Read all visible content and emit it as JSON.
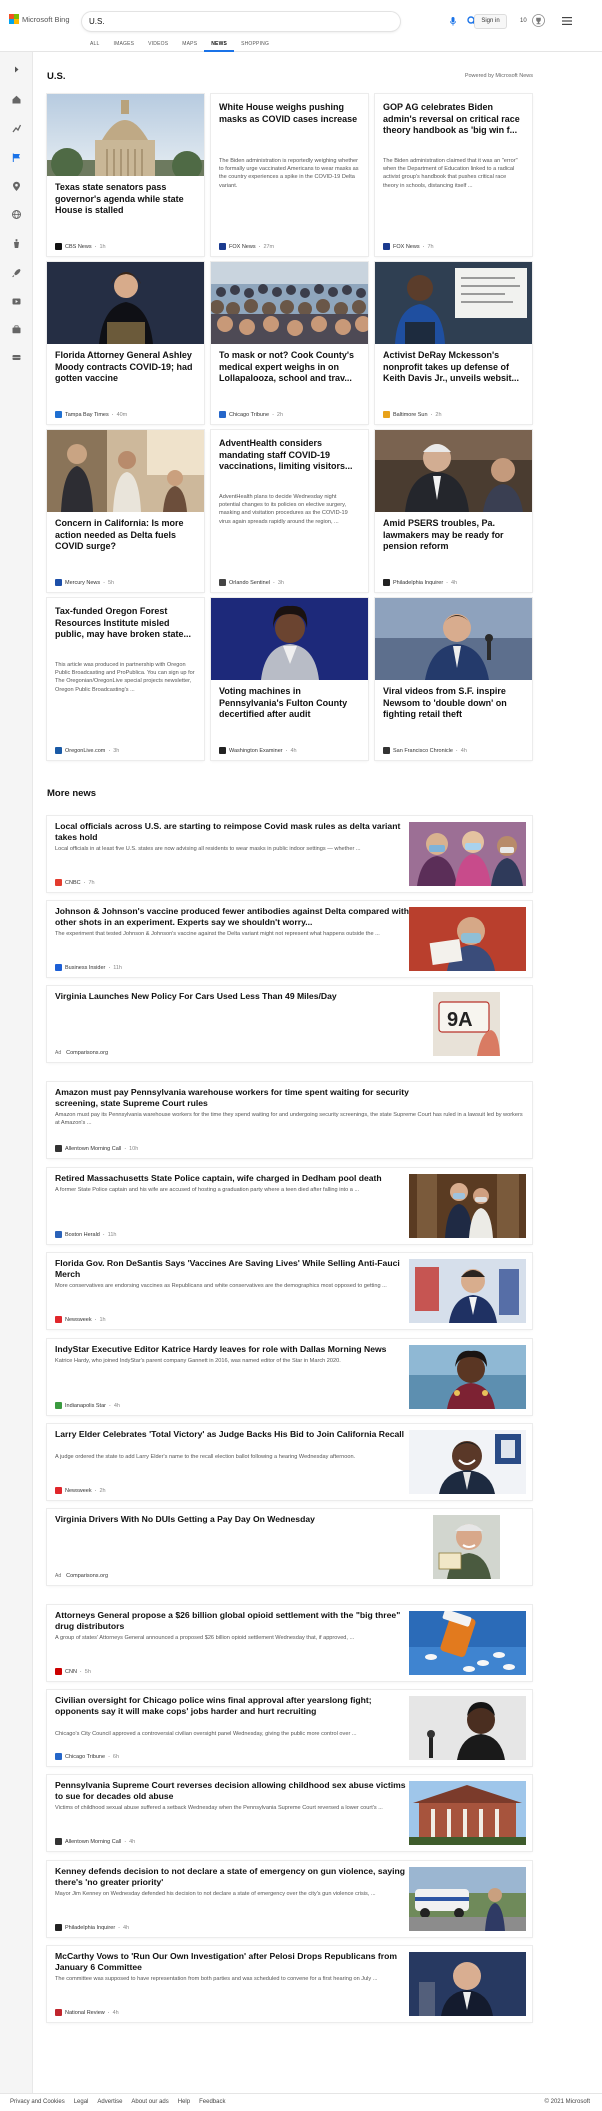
{
  "brand": {
    "name": "Microsoft Bing"
  },
  "search": {
    "value": "U.S."
  },
  "header": {
    "signin_label": "Sign in",
    "rewards_count": "10"
  },
  "tabs": [
    {
      "label": "ALL"
    },
    {
      "label": "IMAGES"
    },
    {
      "label": "VIDEOS"
    },
    {
      "label": "MAPS"
    },
    {
      "label": "NEWS"
    },
    {
      "label": "SHOPPING"
    }
  ],
  "section": {
    "title": "U.S.",
    "powered_by": "Powered by Microsoft News"
  },
  "cards": [
    {
      "title": "Texas state senators pass governor's agenda while state House is stalled",
      "snippet": "",
      "source": "CBS News",
      "time": "1h",
      "logo_color": "#111111"
    },
    {
      "title": "White House weighs pushing masks as COVID cases increase",
      "snippet": "The Biden administration is reportedly weighing whether to formally urge vaccinated Americans to wear masks as the country experiences a spike in the COVID-19 Delta variant.",
      "source": "FOX News",
      "time": "27m",
      "logo_color": "#1b3b8f"
    },
    {
      "title": "GOP AG celebrates Biden admin's reversal on critical race theory handbook as 'big win f...",
      "snippet": "The Biden administration claimed that it was an \"error\" when the Department of Education linked to a radical activist group's handbook that pushes critical race theory in schools, distancing itself ...",
      "source": "FOX News",
      "time": "7h",
      "logo_color": "#1b3b8f"
    },
    {
      "title": "Florida Attorney General Ashley Moody contracts COVID-19; had gotten vaccine",
      "snippet": "",
      "source": "Tampa Bay Times",
      "time": "40m",
      "logo_color": "#1f6fd1"
    },
    {
      "title": "To mask or not? Cook County's medical expert weighs in on Lollapalooza, school and trav...",
      "snippet": "",
      "source": "Chicago Tribune",
      "time": "2h",
      "logo_color": "#2566c9"
    },
    {
      "title": "Activist DeRay Mckesson's nonprofit takes up defense of Keith Davis Jr., unveils websit...",
      "snippet": "",
      "source": "Baltimore Sun",
      "time": "2h",
      "logo_color": "#e8a21a"
    },
    {
      "title": "Concern in California: Is more action needed as Delta fuels COVID surge?",
      "snippet": "",
      "source": "Mercury News",
      "time": "5h",
      "logo_color": "#1d4fa8"
    },
    {
      "title": "AdventHealth considers mandating staff COVID-19 vaccinations, limiting visitors...",
      "snippet": "AdventHealth plans to decide Wednesday night potential changes to its policies on elective surgery, masking and visitation procedures as the COVID-19 virus again spreads rapidly around the region, ...",
      "source": "Orlando Sentinel",
      "time": "3h",
      "logo_color": "#444444"
    },
    {
      "title": "Amid PSERS troubles, Pa. lawmakers may be ready for pension reform",
      "snippet": "",
      "source": "Philadelphia Inquirer",
      "time": "4h",
      "logo_color": "#222222"
    },
    {
      "title": "Tax-funded Oregon Forest Resources Institute misled public, may have broken state...",
      "snippet": "This article was produced in partnership with Oregon Public Broadcasting and ProPublica. You can sign up for The Oregonian/OregonLive special projects newsletter, Oregon Public Broadcasting's ...",
      "source": "OregonLive.com",
      "time": "3h",
      "logo_color": "#1a5aa6"
    },
    {
      "title": "Voting machines in Pennsylvania's Fulton County decertified after audit",
      "snippet": "",
      "source": "Washington Examiner",
      "time": "4h",
      "logo_color": "#222222"
    },
    {
      "title": "Viral videos from S.F. inspire Newsom to 'double down' on fighting retail theft",
      "snippet": "",
      "source": "San Francisco Chronicle",
      "time": "4h",
      "logo_color": "#333333"
    }
  ],
  "more": {
    "title": "More news"
  },
  "rows": [
    {
      "title": "Local officials across U.S. are starting to reimpose Covid mask rules as delta variant takes hold",
      "snippet": "Local officials in at least five U.S. states are now advising all residents to wear masks in public indoor settings — whether ...",
      "source": "CNBC",
      "time": "7h",
      "logo_color": "#e33c2e"
    },
    {
      "title": "Johnson & Johnson's vaccine produced fewer antibodies against Delta compared with other shots in an experiment. Experts say we shouldn't worry...",
      "snippet": "The experiment that tested Johnson & Johnson's vaccine against the Delta variant might not represent what happens outside the ...",
      "source": "Business Insider",
      "time": "11h",
      "logo_color": "#1c5fd6"
    },
    {
      "title": "Virginia Launches New Policy For Cars Used Less Than 49 Miles/Day",
      "snippet": "",
      "ad": "Ad",
      "source": "Comparisons.org",
      "time": "",
      "logo_color": ""
    },
    {
      "title": "Amazon must pay Pennsylvania warehouse workers for time spent waiting for security screening, state Supreme Court rules",
      "snippet": "Amazon must pay its Pennsylvania warehouse workers for the time they spend waiting for and undergoing security screenings, the state Supreme Court has ruled in a lawsuit led by workers at Amazon's ...",
      "source": "Allentown Morning Call",
      "time": "10h",
      "logo_color": "#333333"
    },
    {
      "title": "Retired Massachusetts State Police captain, wife charged in Dedham pool death",
      "snippet": "A former State Police captain and his wife are accused of hosting a graduation party where a teen died after falling into a ...",
      "source": "Boston Herald",
      "time": "11h",
      "logo_color": "#2a62b8"
    },
    {
      "title": "Florida Gov. Ron DeSantis Says 'Vaccines Are Saving Lives' While Selling Anti-Fauci Merch",
      "snippet": "More conservatives are endorsing vaccines as Republicans and white conservatives are the demographics most opposed to getting ...",
      "source": "Newsweek",
      "time": "1h",
      "logo_color": "#e0262b"
    },
    {
      "title": "IndyStar Executive Editor Katrice Hardy leaves for role with Dallas Morning News",
      "snippet": "Katrice Hardy, who joined IndyStar's parent company Gannett in 2016, was named editor of the Star in March 2020.",
      "source": "Indianapolis Star",
      "time": "4h",
      "logo_color": "#3a9a3f"
    },
    {
      "title": "Larry Elder Celebrates 'Total Victory' as Judge Backs His Bid to Join California Recall",
      "snippet": "A judge ordered the state to add Larry Elder's name to the recall election ballot following a hearing Wednesday afternoon.",
      "source": "Newsweek",
      "time": "2h",
      "logo_color": "#e0262b"
    },
    {
      "title": "Virginia Drivers With No DUIs Getting a Pay Day On Wednesday",
      "snippet": "",
      "ad": "Ad",
      "source": "Comparisons.org",
      "time": "",
      "logo_color": ""
    },
    {
      "title": "Attorneys General propose a $26 billion global opioid settlement with the \"big three\" drug distributors",
      "snippet": "A group of states' Attorneys General announced a proposed $26 billion opioid settlement Wednesday that, if approved, ...",
      "source": "CNN",
      "time": "5h",
      "logo_color": "#cc0000"
    },
    {
      "title": "Civilian oversight for Chicago police wins final approval after yearslong fight; opponents say it will make cops' jobs harder and hurt recruiting",
      "snippet": "Chicago's City Council approved a controversial civilian oversight panel Wednesday, giving the public more control over ...",
      "source": "Chicago Tribune",
      "time": "6h",
      "logo_color": "#2566c9"
    },
    {
      "title": "Pennsylvania Supreme Court reverses decision allowing childhood sex abuse victims to sue for decades old abuse",
      "snippet": "Victims of childhood sexual abuse suffered a setback Wednesday when the Pennsylvania Supreme Court reversed a lower court's ...",
      "source": "Allentown Morning Call",
      "time": "4h",
      "logo_color": "#333333"
    },
    {
      "title": "Kenney defends decision to not declare a state of emergency on gun violence, saying there's 'no greater priority'",
      "snippet": "Mayor Jim Kenney on Wednesday defended his decision to not declare a state of emergency over the city's gun violence crisis, ...",
      "source": "Philadelphia Inquirer",
      "time": "4h",
      "logo_color": "#222222"
    },
    {
      "title": "McCarthy Vows to 'Run Our Own Investigation' after Pelosi Drops Republicans from January 6 Committee",
      "snippet": "The committee was supposed to have representation from both parties and was scheduled to convene for a first hearing on July ...",
      "source": "National Review",
      "time": "4h",
      "logo_color": "#c0262d"
    }
  ],
  "footer": {
    "links": [
      "Privacy and Cookies",
      "Legal",
      "Advertise",
      "About our ads",
      "Help",
      "Feedback"
    ],
    "copyright": "© 2021 Microsoft"
  }
}
